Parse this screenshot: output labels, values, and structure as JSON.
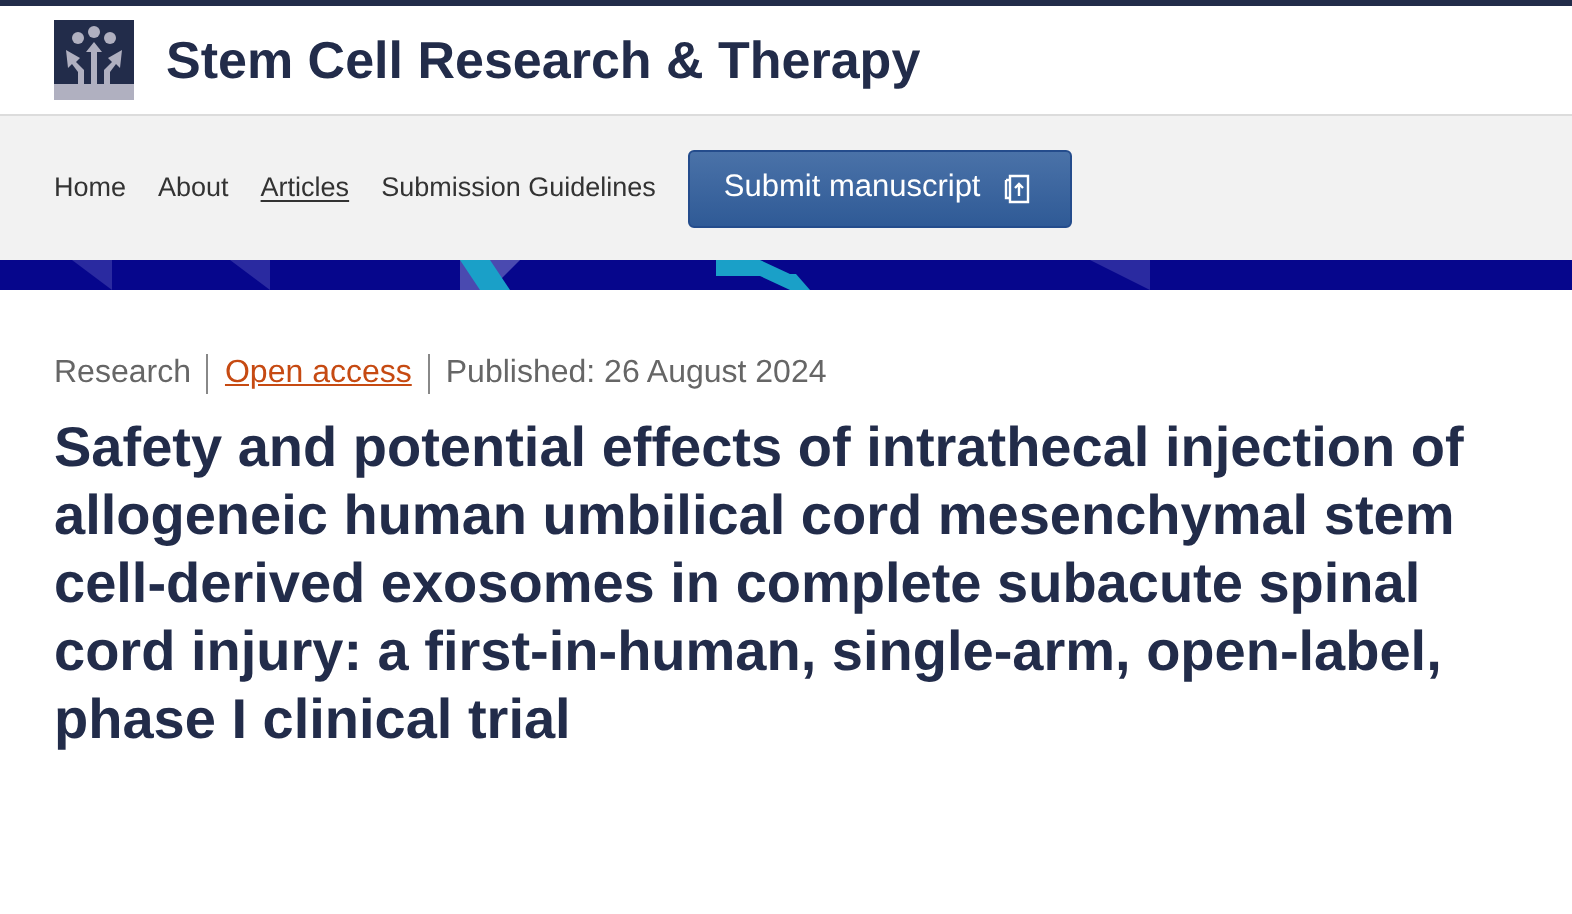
{
  "journal": {
    "title": "Stem Cell Research & Therapy"
  },
  "nav": {
    "items": [
      {
        "label": "Home",
        "selected": false
      },
      {
        "label": "About",
        "selected": false
      },
      {
        "label": "Articles",
        "selected": true
      },
      {
        "label": "Submission Guidelines",
        "selected": false
      }
    ],
    "submit_button": "Submit manuscript"
  },
  "article": {
    "meta": [
      {
        "kind": "type",
        "text": "Research"
      },
      {
        "kind": "link",
        "text": "Open access"
      },
      {
        "kind": "date",
        "text": "Published: 26 August 2024"
      }
    ],
    "title": "Safety and potential effects of intrathecal injection of allogeneic human umbilical cord mesenchymal stem cell-derived exosomes in complete subacute spinal cord injury: a first-in-human, single-arm, open-label, phase I clinical trial"
  }
}
